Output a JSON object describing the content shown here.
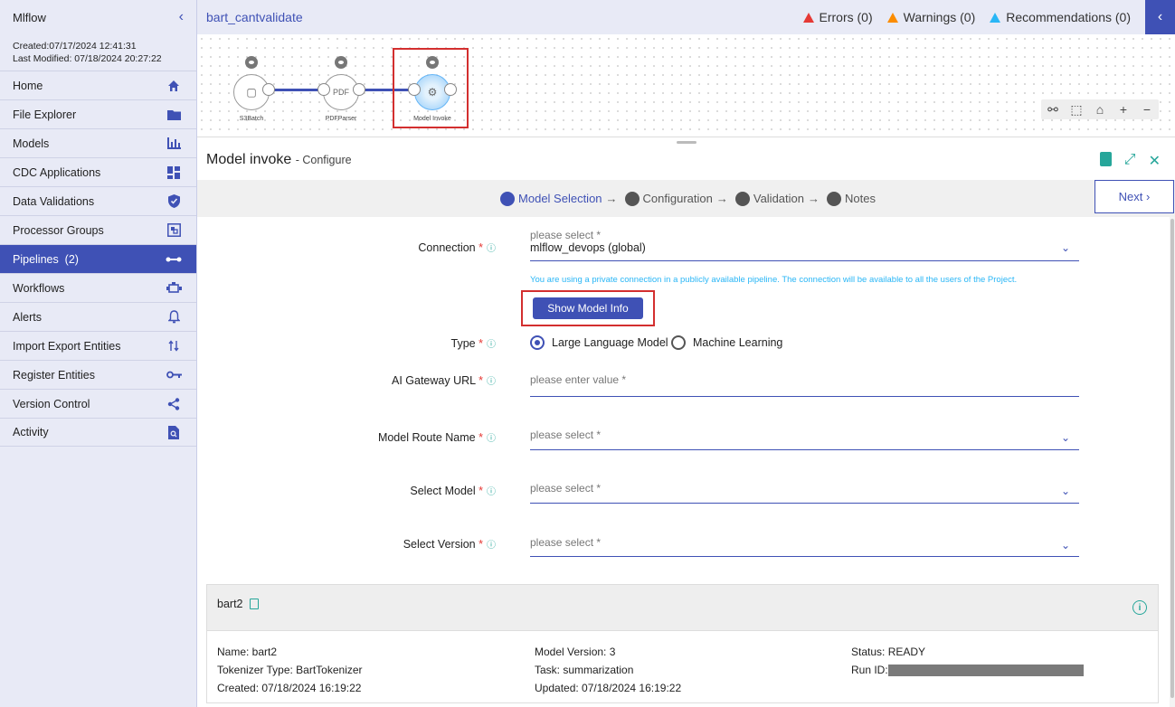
{
  "sidebar": {
    "title": "Mlflow",
    "created": "Created:07/17/2024 12:41:31",
    "modified": "Last Modified: 07/18/2024 20:27:22",
    "items": [
      {
        "label": "Home",
        "icon": "home-icon"
      },
      {
        "label": "File Explorer",
        "icon": "folder-icon"
      },
      {
        "label": "Models",
        "icon": "bar-chart-icon"
      },
      {
        "label": "CDC Applications",
        "icon": "dashboard-icon"
      },
      {
        "label": "Data Validations",
        "icon": "shield-check-icon"
      },
      {
        "label": "Processor Groups",
        "icon": "group-icon"
      },
      {
        "label": "Pipelines  (2)",
        "icon": "pipeline-icon",
        "active": true
      },
      {
        "label": "Workflows",
        "icon": "workflow-icon"
      },
      {
        "label": "Alerts",
        "icon": "bell-icon"
      },
      {
        "label": "Import Export Entities",
        "icon": "import-export-icon"
      },
      {
        "label": "Register Entities",
        "icon": "key-icon"
      },
      {
        "label": "Version Control",
        "icon": "share-icon"
      },
      {
        "label": "Activity",
        "icon": "activity-search-icon"
      }
    ]
  },
  "header": {
    "pipeline_name": "bart_cantvalidate",
    "errors": "Errors (0)",
    "warnings": "Warnings (0)",
    "recommendations": "Recommendations (0)"
  },
  "canvas": {
    "nodes": [
      {
        "label": "S3Batch"
      },
      {
        "label": "PDFParser"
      },
      {
        "label": "Model Invoke"
      }
    ]
  },
  "configure": {
    "title": "Model invoke",
    "subtitle": "- Configure"
  },
  "stepper": {
    "steps": [
      "Model Selection",
      "Configuration",
      "Validation",
      "Notes"
    ],
    "arrow": "→",
    "next_label": "Next"
  },
  "form": {
    "connection": {
      "label": "Connection",
      "placeholder": "please select *",
      "value": "mlflow_devops (global)"
    },
    "hint": "You are using a private connection in a publicly available pipeline. The connection will be available to all the users of the Project.",
    "show_model_info": "Show Model Info",
    "type": {
      "label": "Type",
      "options": [
        "Large Language Model",
        "Machine Learning"
      ],
      "selected": "Large Language Model"
    },
    "gateway_url": {
      "label": "AI Gateway URL",
      "placeholder": "please enter value *"
    },
    "model_route": {
      "label": "Model Route Name",
      "placeholder": "please select *"
    },
    "select_model": {
      "label": "Select Model",
      "placeholder": "please select *"
    },
    "select_version": {
      "label": "Select Version",
      "placeholder": "please select *"
    },
    "required_mark": "*"
  },
  "model_info": {
    "name_header": "bart2",
    "name": "Name: bart2",
    "tokenizer": "Tokenizer Type: BartTokenizer",
    "created": "Created: 07/18/2024 16:19:22",
    "version": "Model Version: 3",
    "task": "Task: summarization",
    "updated": "Updated: 07/18/2024 16:19:22",
    "status": "Status: READY",
    "run_id_label": "Run ID:"
  },
  "colors": {
    "accent": "#3f51b5",
    "teal": "#26a69a",
    "highlight": "#d32f2f"
  }
}
